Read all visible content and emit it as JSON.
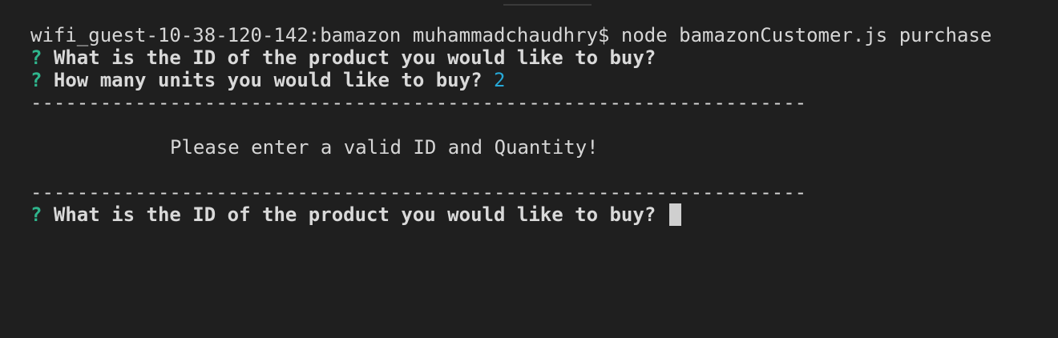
{
  "terminal": {
    "command_line": "wifi_guest-10-38-120-142:bamazon muhammadchaudhry$ node bamazonCustomer.js purchase",
    "prompt_marker": "?",
    "question_id": "What is the ID of the product you would like to buy?",
    "question_units": "How many units you would like to buy?",
    "units_answer": "2",
    "separator": "-------------------------------------------------------------------",
    "error_message": "Please enter a valid ID and Quantity!",
    "question_id_repeat": "What is the ID of the product you would like to buy?"
  },
  "colors": {
    "background": "#1f1f1f",
    "text": "#d6d6d6",
    "prompt_marker": "#2fb58c",
    "answer": "#27a9d8",
    "cursor": "#cfcfcf"
  }
}
